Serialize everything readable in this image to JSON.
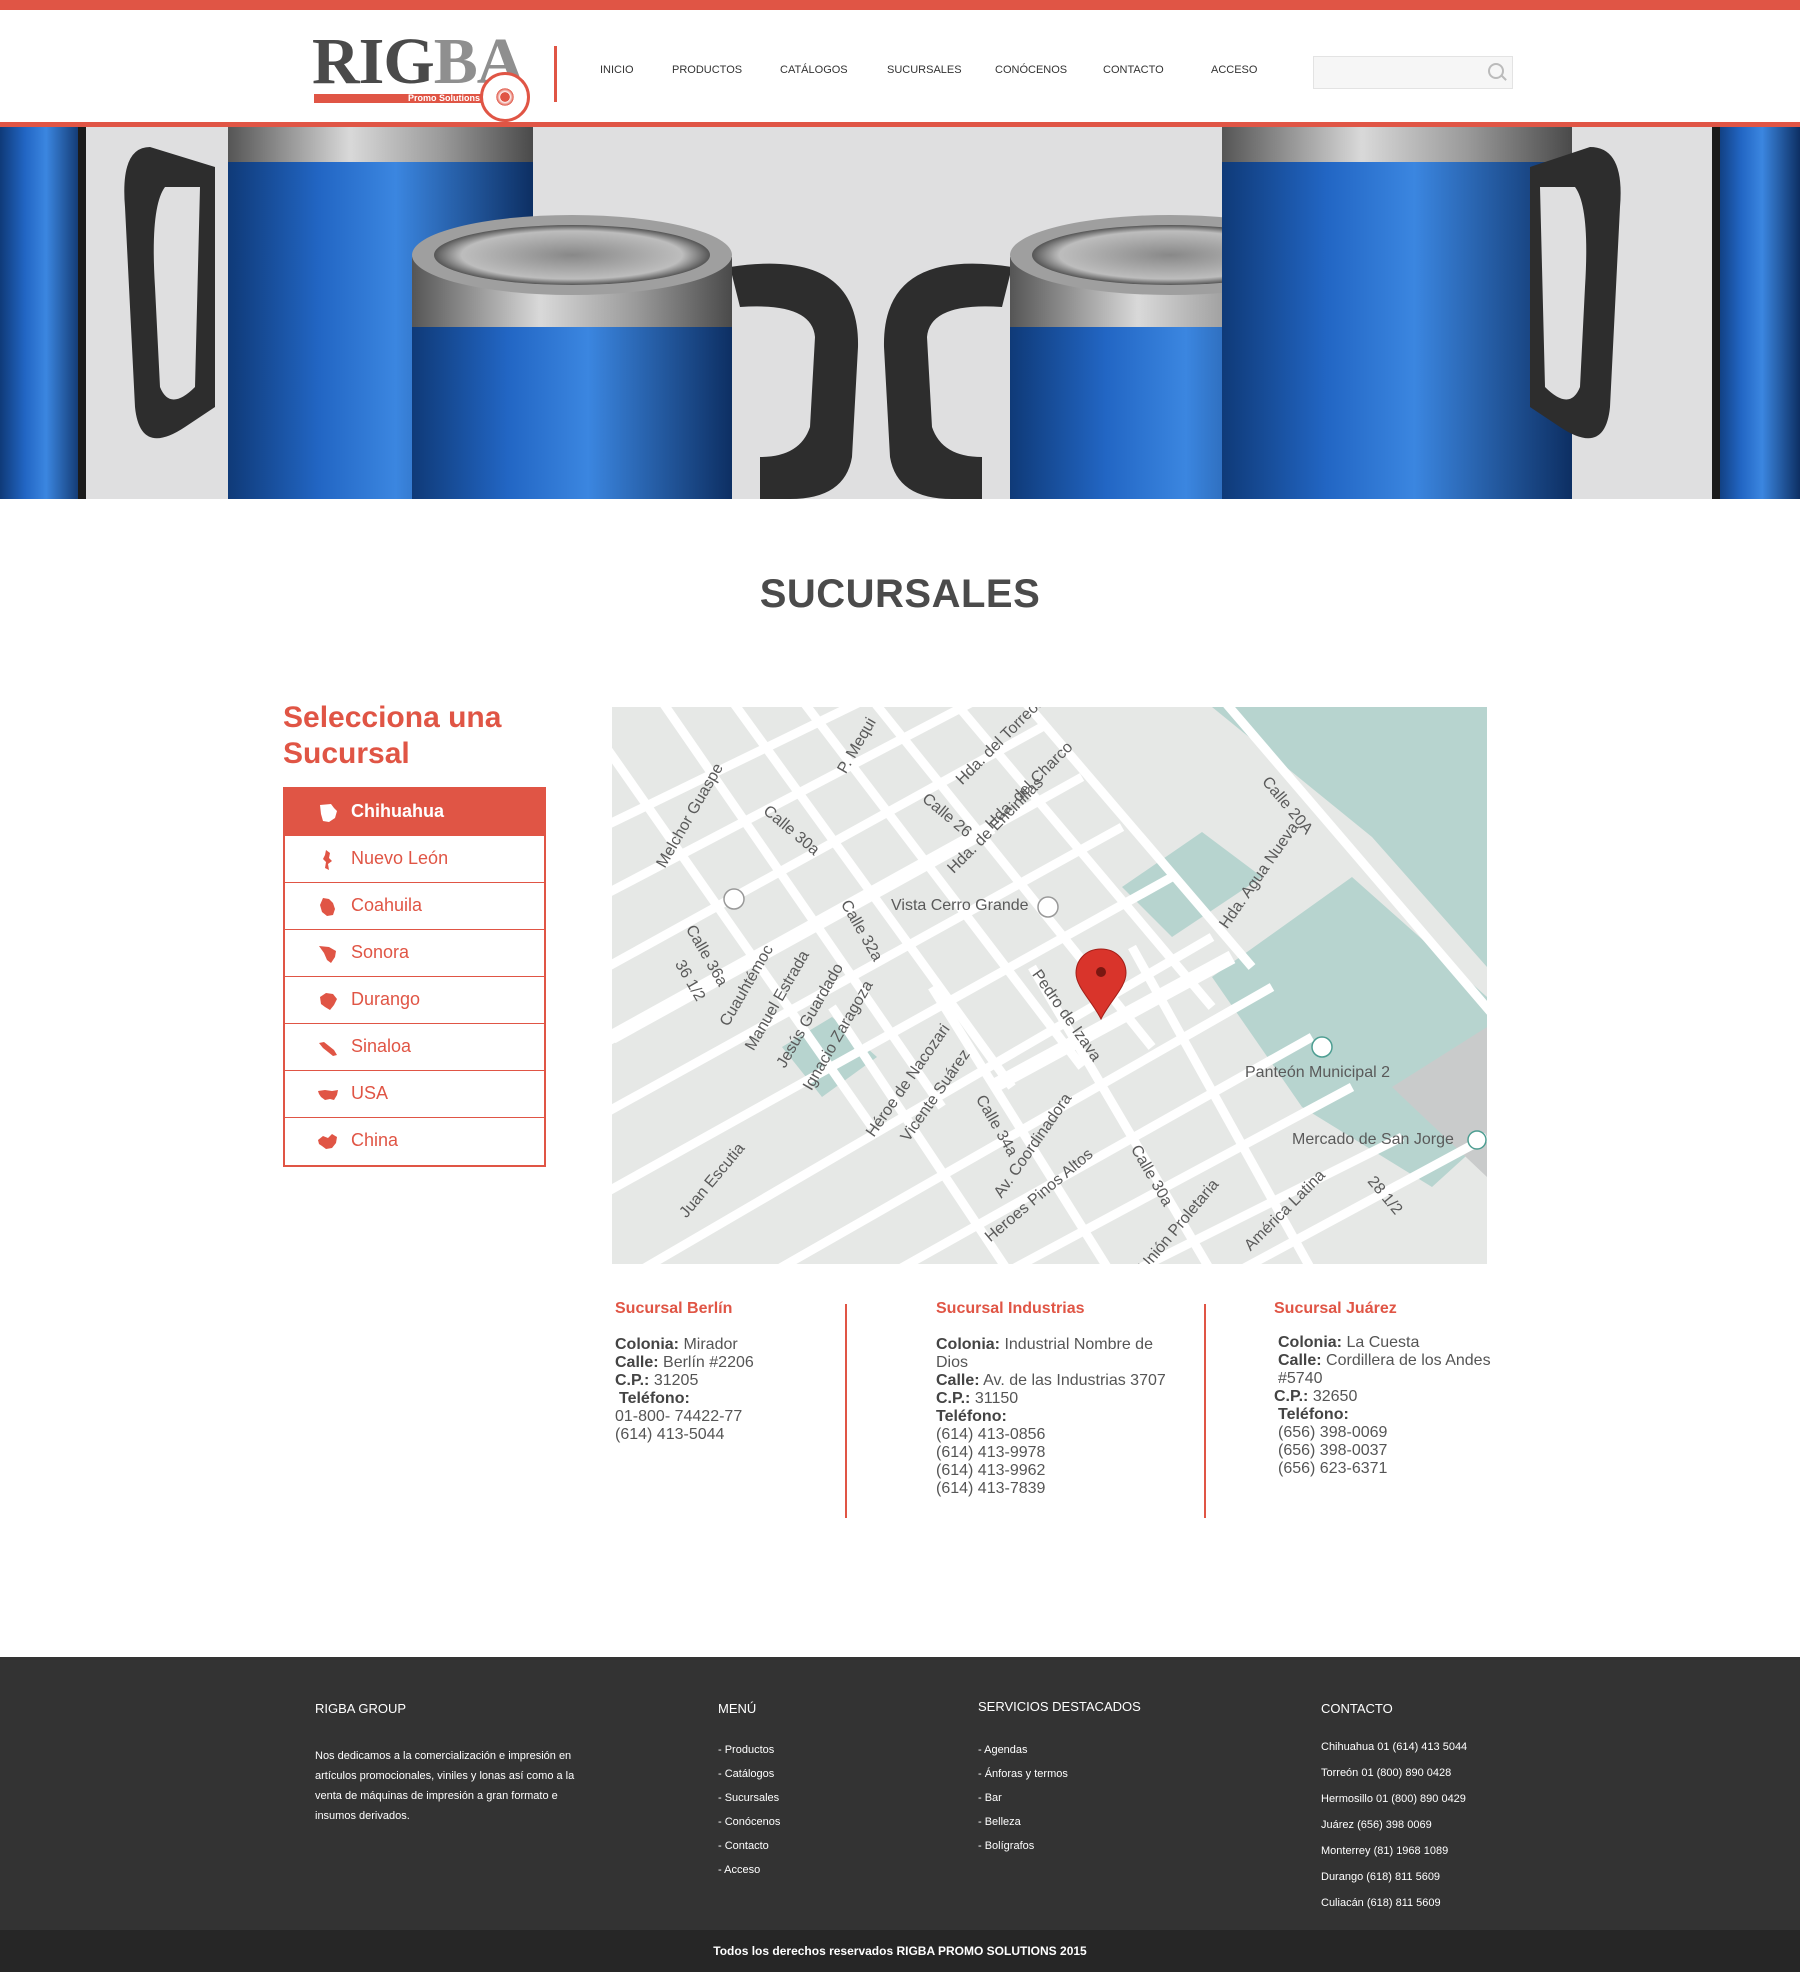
{
  "logo": {
    "text_dark": "RIG",
    "text_light": "BA",
    "subtitle": "Promo Solutions"
  },
  "nav": [
    {
      "label": "INICIO"
    },
    {
      "label": "PRODUCTOS"
    },
    {
      "label": "CATÁLOGOS"
    },
    {
      "label": "SUCURSALES"
    },
    {
      "label": "CONÓCENOS"
    },
    {
      "label": "CONTACTO"
    },
    {
      "label": "ACCESO"
    }
  ],
  "search": {
    "placeholder": "",
    "icon": "search-icon"
  },
  "hero": {
    "image": "blue-travel-mugs-banner"
  },
  "page_title": "SUCURSALES",
  "branch_selector": {
    "heading": "Selecciona una Sucursal",
    "items": [
      {
        "label": "Chihuahua",
        "icon": "chihuahua-state-icon",
        "active": true
      },
      {
        "label": "Nuevo León",
        "icon": "nuevo-leon-state-icon",
        "active": false
      },
      {
        "label": "Coahuila",
        "icon": "coahuila-state-icon",
        "active": false
      },
      {
        "label": "Sonora",
        "icon": "sonora-state-icon",
        "active": false
      },
      {
        "label": "Durango",
        "icon": "durango-state-icon",
        "active": false
      },
      {
        "label": "Sinaloa",
        "icon": "sinaloa-state-icon",
        "active": false
      },
      {
        "label": "USA",
        "icon": "usa-map-icon",
        "active": false
      },
      {
        "label": "China",
        "icon": "china-map-icon",
        "active": false
      }
    ]
  },
  "map": {
    "labels": {
      "vista": "Vista Cerro Grande",
      "panteon": "Panteón Municipal 2",
      "mercado": "Mercado de San Jorge",
      "melchor": "Melchor Guaspe",
      "pedro": "Pedro de Izava",
      "cuauhtemoc": "Cuauhtémoc",
      "manuel": "Manuel Estrada",
      "jesus": "Jesús Guardado",
      "ignacio": "Ignacio Zaragoza",
      "heroe": "Héroe de Nacozari",
      "vicente": "Vicente Suárez",
      "coordinadora": "Av. Coordinadora",
      "heroes": "Heroes Pinos Altos",
      "agua": "Hda. Agua Nueva",
      "encinillas": "Hda. de Encinillas",
      "charco": "Hda. del Charco",
      "torreon": "Hda. del Torreón",
      "c20a": "Calle 20A",
      "c30a": "Calle 30a",
      "c32a": "Calle 32a",
      "c36a": "Calle 36a",
      "c34a": "Calle 34a",
      "c26": "Calle 26",
      "c30a2": "Calle 30a",
      "juan": "Juan Escutia",
      "america": "América Latina",
      "proletaria": "Unión Proletaria",
      "pmequi": "P. Mequi",
      "n28": "28 1/2",
      "n36": "36 1/2"
    },
    "marker_color": "#d9342b"
  },
  "sucursales": [
    {
      "title": "Sucursal Berlín",
      "colonia_label": "Colonia:",
      "colonia": "Mirador",
      "calle_label": "Calle:",
      "calle": "Berlín #2206",
      "cp_label": "C.P.:",
      "cp": "31205",
      "tel_label": "Teléfono:",
      "phones": [
        "01-800- 74422-77",
        "(614) 413-5044"
      ]
    },
    {
      "title": "Sucursal Industrias",
      "colonia_label": "Colonia:",
      "colonia": "Industrial Nombre de Dios",
      "calle_label": "Calle:",
      "calle": "Av. de las Industrias 3707",
      "cp_label": "C.P.:",
      "cp": "31150",
      "tel_label": "Teléfono:",
      "phones": [
        "(614) 413-0856",
        "(614) 413-9978",
        "(614) 413-9962",
        "(614) 413-7839"
      ]
    },
    {
      "title": "Sucursal Juárez",
      "colonia_label": "Colonia:",
      "colonia": "La Cuesta",
      "calle_label": "Calle:",
      "calle": "Cordillera de los Andes #5740",
      "cp_label": "C.P.:",
      "cp": "32650",
      "tel_label": "Teléfono:",
      "phones": [
        "(656) 398-0069",
        "(656) 398-0037",
        "(656) 623-6371"
      ]
    }
  ],
  "footer": {
    "group": {
      "title": "RIGBA GROUP",
      "text": "Nos dedicamos a la comercialización e impresión en artículos promocionales, viniles y lonas así como a la venta de máquinas de impresión a gran formato e insumos derivados."
    },
    "menu": {
      "title": "MENÚ",
      "items": [
        "- Productos",
        "- Catálogos",
        "-  Sucursales",
        "- Conócenos",
        "- Contacto",
        "- Acceso"
      ]
    },
    "services": {
      "title": "SERVICIOS DESTACADOS",
      "items": [
        "- Agendas",
        "- Ánforas y termos",
        "- Bar",
        "- Belleza",
        "- Bolígrafos"
      ]
    },
    "contact": {
      "title": "CONTACTO",
      "items": [
        "Chihuahua 01 (614) 413 5044",
        "Torreón 01 (800) 890 0428",
        "Hermosillo 01 (800) 890 0429",
        "Juárez (656) 398 0069",
        "Monterrey (81) 1968 1089",
        "Durango (618) 811 5609",
        "Culiacán (618) 811 5609"
      ]
    },
    "copyright": "Todos los derechos reservados RIGBA PROMO SOLUTIONS 2015"
  },
  "colors": {
    "accent": "#e05545",
    "footer_bg": "#333333",
    "bottom_bar": "#262626",
    "map_land": "#e6e8e6",
    "map_park": "#b7d4cf"
  }
}
